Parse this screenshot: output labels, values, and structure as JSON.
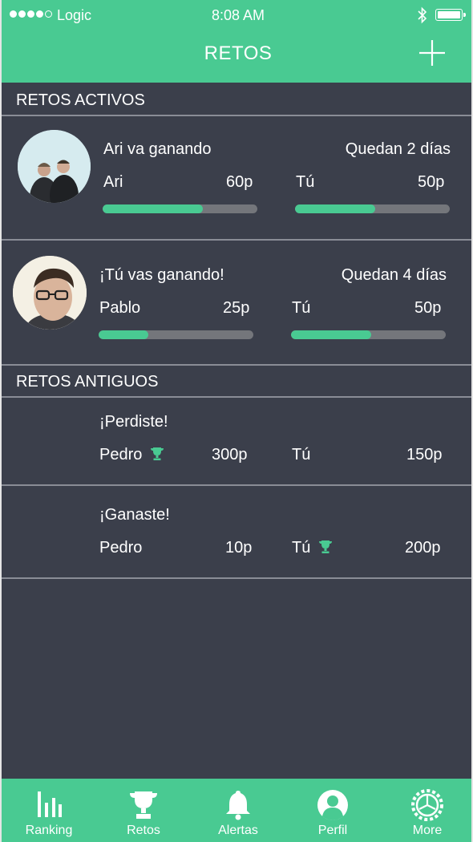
{
  "status_bar": {
    "carrier": "Logic",
    "time": "8:08 AM"
  },
  "header": {
    "title": "RETOS",
    "add_icon": "plus-icon"
  },
  "sections": {
    "active_title": "RETOS ACTIVOS",
    "old_title": "RETOS ANTIGUOS"
  },
  "active": [
    {
      "status": "Ari va ganando",
      "remaining": "Quedan 2 días",
      "left_name": "Ari",
      "left_points": "60p",
      "left_progress": 0.65,
      "right_name": "Tú",
      "right_points": "50p",
      "right_progress": 0.52
    },
    {
      "status": "¡Tú vas ganando!",
      "remaining": "Quedan 4 días",
      "left_name": "Pablo",
      "left_points": "25p",
      "left_progress": 0.32,
      "right_name": "Tú",
      "right_points": "50p",
      "right_progress": 0.52
    }
  ],
  "old": [
    {
      "result": "¡Perdiste!",
      "left_name": "Pedro",
      "left_points": "300p",
      "right_name": "Tú",
      "right_points": "150p",
      "winner": "left"
    },
    {
      "result": "¡Ganaste!",
      "left_name": "Pedro",
      "left_points": "10p",
      "right_name": "Tú",
      "right_points": "200p",
      "winner": "right"
    }
  ],
  "tabs": [
    {
      "label": "Ranking",
      "icon": "bar-chart-icon"
    },
    {
      "label": "Retos",
      "icon": "trophy-icon"
    },
    {
      "label": "Alertas",
      "icon": "bell-icon"
    },
    {
      "label": "Perfil",
      "icon": "user-icon"
    },
    {
      "label": "More",
      "icon": "settings-icon"
    }
  ],
  "colors": {
    "accent": "#49ca92",
    "background": "#3b3f4b",
    "bar_track": "#74767b"
  }
}
